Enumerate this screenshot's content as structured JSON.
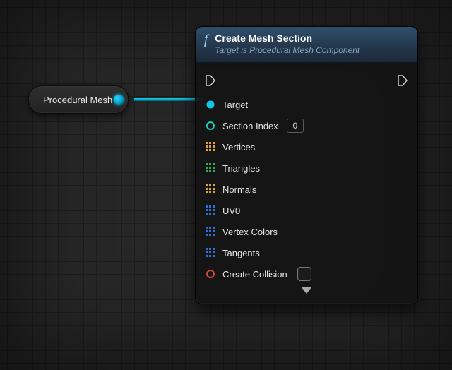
{
  "source_node": {
    "label": "Procedural Mesh"
  },
  "node": {
    "title": "Create Mesh Section",
    "subtitle": "Target is Procedural Mesh Component",
    "pins": {
      "target": "Target",
      "section_index": {
        "label": "Section Index",
        "value": "0"
      },
      "vertices": "Vertices",
      "triangles": "Triangles",
      "normals": "Normals",
      "uv0": "UV0",
      "vertex_colors": "Vertex Colors",
      "tangents": "Tangents",
      "create_collision": "Create Collision"
    }
  }
}
